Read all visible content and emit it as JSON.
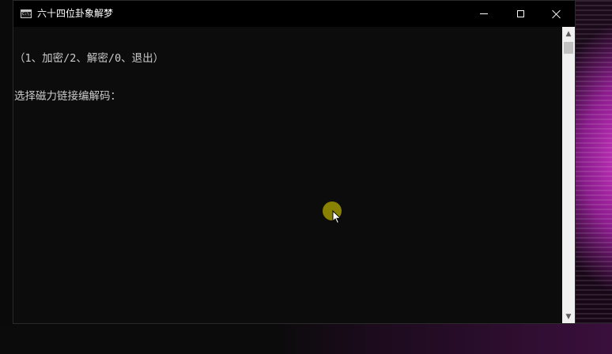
{
  "window": {
    "title": "六十四位卦象解梦",
    "icon": "console-icon",
    "icon_text": "C:\\."
  },
  "caption_buttons": {
    "minimize": "minimize-icon",
    "maximize": "maximize-icon",
    "close": "close-icon"
  },
  "console": {
    "lines": [
      "（1、加密/2、解密/0、退出）",
      "选择磁力链接编解码："
    ]
  },
  "scrollbar": {
    "up_arrow": "▲",
    "down_arrow": "▼"
  },
  "colors": {
    "console_bg": "#0c0c0c",
    "console_text": "#cccccc",
    "titlebar_bg": "#000000",
    "cursor_halo": "#a09600"
  }
}
